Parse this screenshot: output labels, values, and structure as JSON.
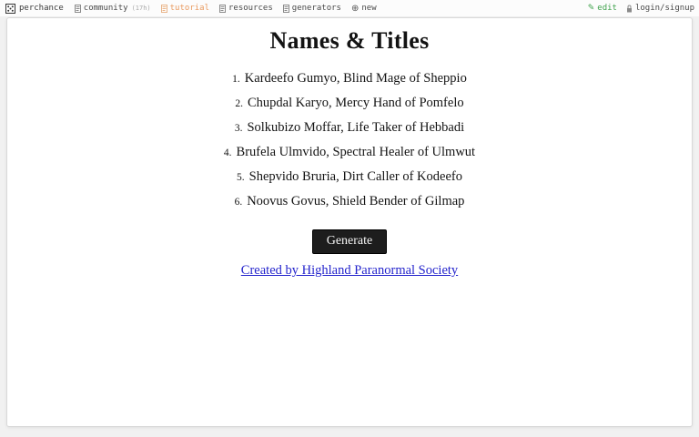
{
  "topbar": {
    "brand": "perchance",
    "nav": [
      {
        "label": "community",
        "suffix": "(17h)"
      },
      {
        "label": "tutorial",
        "suffix": ""
      },
      {
        "label": "resources",
        "suffix": ""
      },
      {
        "label": "generators",
        "suffix": ""
      }
    ],
    "new_item": {
      "glyph": "⊕",
      "label": "new"
    },
    "edit": {
      "glyph": "✎",
      "label": "edit"
    },
    "login": {
      "label": "login/signup"
    }
  },
  "generator": {
    "title": "Names & Titles",
    "results": [
      {
        "number": "1.",
        "text": "Kardeefo Gumyo, Blind Mage of Sheppio"
      },
      {
        "number": "2.",
        "text": "Chupdal Karyo, Mercy Hand of Pomfelo"
      },
      {
        "number": "3.",
        "text": "Solkubizo Moffar, Life Taker of Hebbadi"
      },
      {
        "number": "4.",
        "text": "Brufela Ulmvido, Spectral Healer of Ulmwut"
      },
      {
        "number": "5.",
        "text": "Shepvido Bruria, Dirt Caller of Kodeefo"
      },
      {
        "number": "6.",
        "text": "Noovus Govus, Shield Bender of Gilmap"
      }
    ],
    "generate_label": "Generate",
    "credit_link": "Created by Highland Paranormal Society"
  },
  "icons": {
    "logo": "dice-logo-icon",
    "nav_item": "book-icon",
    "new": "circle-plus-icon",
    "edit": "pencil-icon",
    "login": "lock-icon"
  },
  "colors": {
    "page_bg": "#f1f1f1",
    "frame_bg": "#ffffff",
    "frame_border": "#d9d9d9",
    "nav_text": "#4a4a4a",
    "tutorial_orange": "#e99a5f",
    "edit_green": "#3fa24c",
    "link_blue": "#2323cc",
    "button_bg": "#1d1d1d",
    "button_text": "#f4f4f4"
  }
}
